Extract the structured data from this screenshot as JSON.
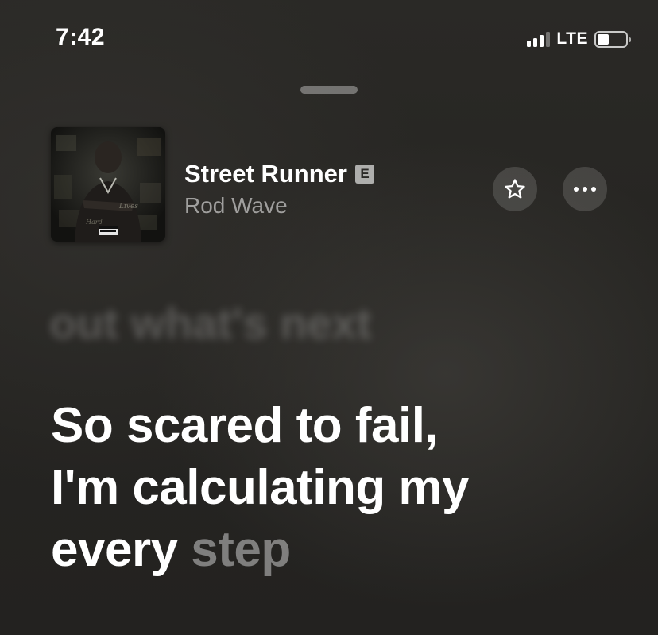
{
  "status_bar": {
    "time": "7:42",
    "network": "LTE"
  },
  "now_playing": {
    "title": "Street Runner",
    "explicit_label": "E",
    "artist": "Rod Wave",
    "icons": {
      "favorite": "star-icon",
      "more": "ellipsis-icon"
    }
  },
  "lyrics": {
    "previous_line": "out what's next",
    "current_lines": [
      "So scared to fail,",
      "I'm calculating my"
    ],
    "current_sung": "every",
    "current_upcoming": "step"
  }
}
